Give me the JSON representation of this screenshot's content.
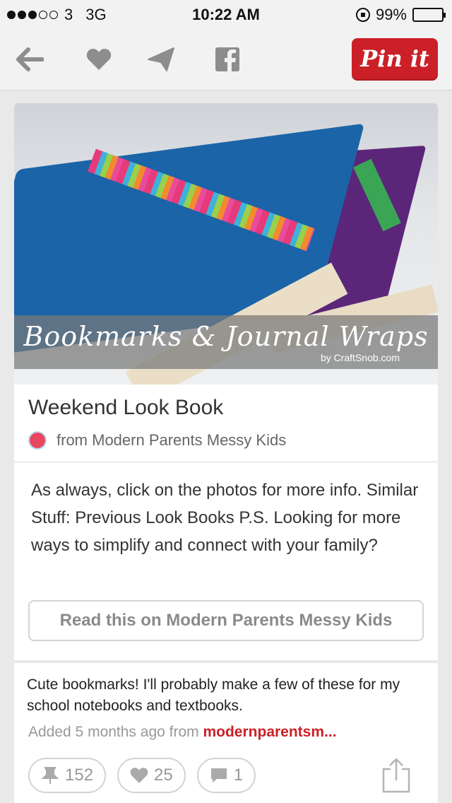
{
  "status_bar": {
    "carrier": "3",
    "network": "3G",
    "time": "10:22 AM",
    "battery": "99%",
    "battery_level": 0.99
  },
  "toolbar": {
    "back_icon": "back-arrow-icon",
    "like_icon": "heart-icon",
    "send_icon": "paper-plane-icon",
    "facebook_icon": "facebook-icon",
    "pin_it_label": "Pin it",
    "accent": "#cb2027"
  },
  "pin": {
    "image_caption": "Bookmarks & Journal Wraps",
    "image_credit": "by CraftSnob.com",
    "title": "Weekend Look Book",
    "source": "from Modern Parents Messy Kids",
    "description": "As always, click on the photos for more info. Similar Stuff: Previous Look Books P.S. Looking for more ways to simplify and connect with your family?",
    "read_button": "Read this on Modern Parents Messy Kids"
  },
  "details": {
    "comment": "Cute bookmarks! I'll probably make a few of these for my school notebooks and textbooks.",
    "added_prefix": "Added 5 months ago from ",
    "added_source": "modernparentsm...",
    "repins": "152",
    "likes": "25",
    "comments": "1"
  }
}
